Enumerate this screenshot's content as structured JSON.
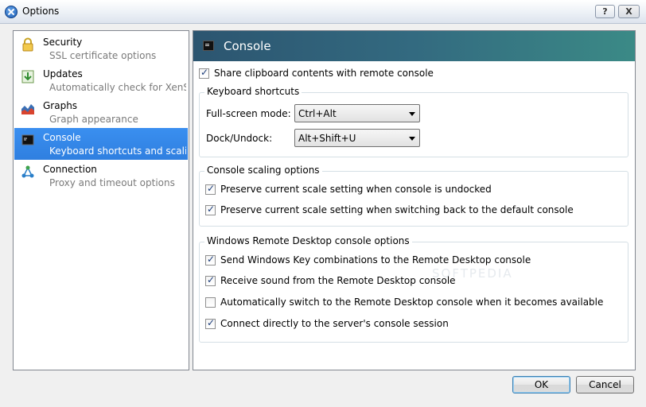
{
  "window": {
    "title": "Options",
    "help_label": "?",
    "close_label": "X"
  },
  "nav": {
    "items": [
      {
        "title": "Security",
        "subtitle": "SSL certificate options",
        "icon": "lock-icon"
      },
      {
        "title": "Updates",
        "subtitle": "Automatically check for XenS...",
        "icon": "download-icon"
      },
      {
        "title": "Graphs",
        "subtitle": "Graph appearance",
        "icon": "graph-icon"
      },
      {
        "title": "Console",
        "subtitle": "Keyboard shortcuts and scalin...",
        "icon": "console-icon",
        "selected": true
      },
      {
        "title": "Connection",
        "subtitle": "Proxy and timeout options",
        "icon": "network-icon"
      }
    ]
  },
  "panel": {
    "title": "Console",
    "share_clipboard": {
      "label": "Share clipboard contents with remote console",
      "checked": true
    },
    "keyboard": {
      "group_title": "Keyboard shortcuts",
      "fullscreen_label": "Full-screen mode:",
      "fullscreen_value": "Ctrl+Alt",
      "dock_label": "Dock/Undock:",
      "dock_value": "Alt+Shift+U"
    },
    "scaling": {
      "group_title": "Console scaling options",
      "options": [
        {
          "label": "Preserve current scale setting when console is undocked",
          "checked": true
        },
        {
          "label": "Preserve current scale setting when switching back to the default console",
          "checked": true
        }
      ]
    },
    "rdp": {
      "group_title": "Windows Remote Desktop console options",
      "options": [
        {
          "label": "Send Windows Key combinations to the Remote Desktop console",
          "checked": true
        },
        {
          "label": "Receive sound from the Remote Desktop console",
          "checked": true
        },
        {
          "label": "Automatically switch to the Remote Desktop console when it becomes available",
          "checked": false
        },
        {
          "label": "Connect directly to the server's console session",
          "checked": true
        }
      ]
    },
    "watermark": "SOFTPEDIA"
  },
  "buttons": {
    "ok": "OK",
    "cancel": "Cancel"
  }
}
